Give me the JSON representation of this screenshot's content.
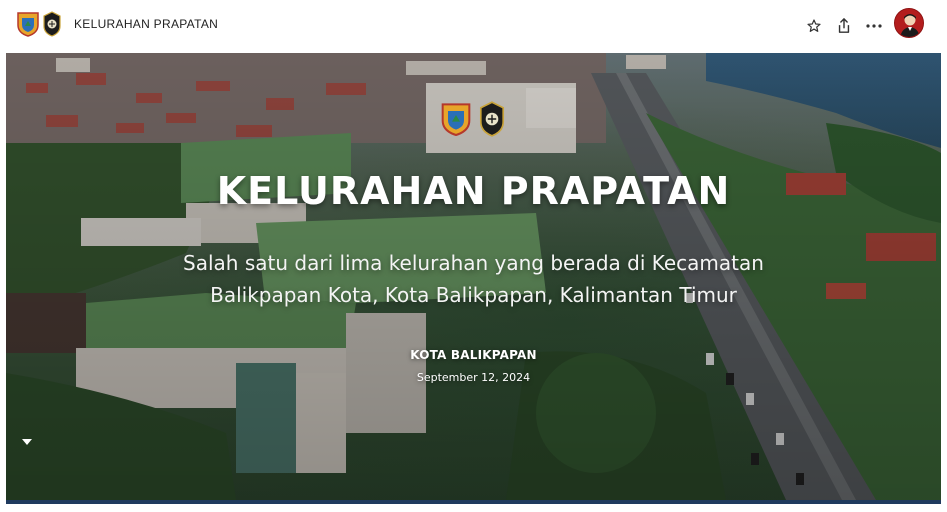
{
  "header": {
    "site_title": "KELURAHAN PRAPATAN",
    "logo_left_icon": "city-emblem-icon",
    "logo_right_icon": "seal-emblem-icon",
    "actions": {
      "star_icon": "star-icon",
      "share_icon": "share-icon",
      "more_icon": "more-dots-icon",
      "avatar_icon": "user-avatar"
    }
  },
  "hero": {
    "title": "KELURAHAN PRAPATAN",
    "subtitle_line1": "Salah satu dari lima kelurahan yang berada di Kecamatan",
    "subtitle_line2": "Balikpapan Kota, Kota Balikpapan, Kalimantan Timur",
    "location": "KOTA BALIKPAPAN",
    "date": "September 12, 2024",
    "scroll_icon": "chevron-down-icon"
  },
  "colors": {
    "accent_bar": "#1f3a5e",
    "avatar_bg": "#b31d1d",
    "hero_overlay": "#3f5a3f"
  }
}
